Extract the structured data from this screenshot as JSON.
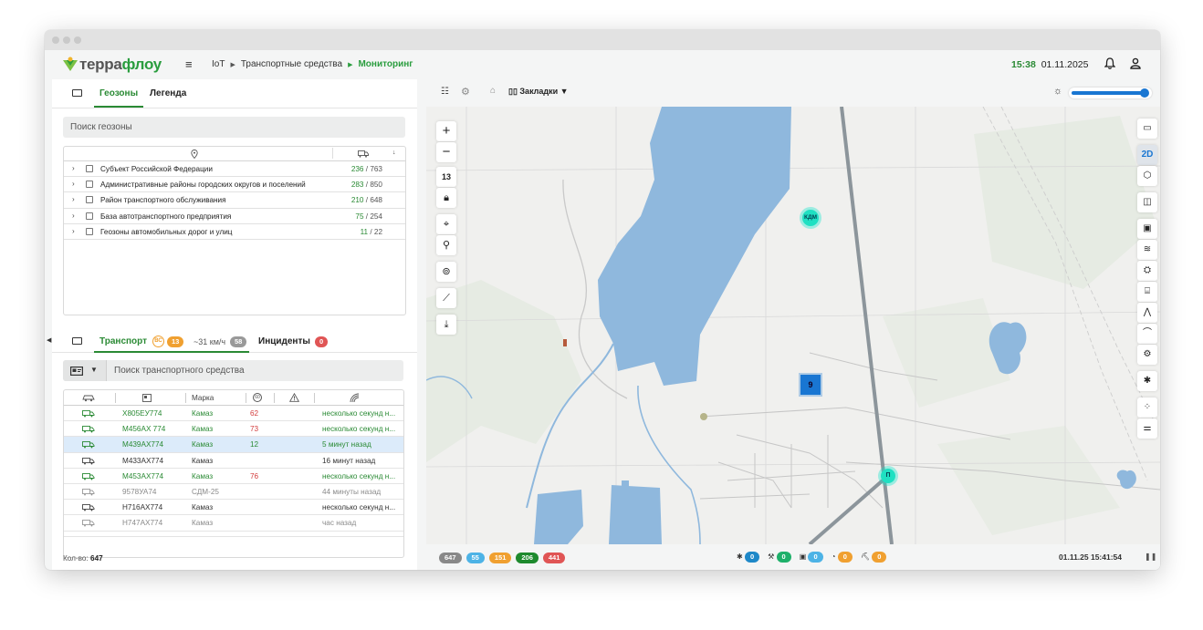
{
  "app": {
    "logo_part1": "терра",
    "logo_part2": "флоу",
    "menu_icon": "≡",
    "breadcrumb": [
      "IoT",
      "Транспортные средства",
      "Мониторинг"
    ],
    "time": "15:38",
    "date": "01.11.2025"
  },
  "geozones": {
    "tabs": [
      "Геозоны",
      "Легенда"
    ],
    "search_placeholder": "Поиск геозоны",
    "rows": [
      {
        "name": "Субъект Российской Федерации",
        "a": "236",
        "b": "763"
      },
      {
        "name": "Административные районы городских округов и поселений",
        "a": "283",
        "b": "850"
      },
      {
        "name": "Район транспортного обслуживания",
        "a": "210",
        "b": "648"
      },
      {
        "name": "База автотранспортного предприятия",
        "a": "75",
        "b": "254"
      },
      {
        "name": "Геозоны автомобильных дорог и улиц",
        "a": "11",
        "b": "22"
      }
    ]
  },
  "transport": {
    "tab_transport": "Транспорт",
    "count_badge": "13",
    "speed_label": "~31 км/ч",
    "speed_badge": "58",
    "tab_incidents": "Инциденты",
    "incidents_badge": "0",
    "search_placeholder": "Поиск транспортного средства",
    "col_brand": "Марка",
    "rows": [
      {
        "plate": "Х805ЕУ774",
        "brand": "Камаз",
        "speed": "62",
        "time": "несколько секунд н...",
        "style": "green"
      },
      {
        "plate": "М456АХ 774",
        "brand": "Камаз",
        "speed": "73",
        "time": "несколько секунд н...",
        "style": "green"
      },
      {
        "plate": "М439АХ774",
        "brand": "Камаз",
        "speed": "12",
        "time": "5 минут назад",
        "style": "green-sel"
      },
      {
        "plate": "М433АХ774",
        "brand": "Камаз",
        "speed": "",
        "time": "16 минут назад",
        "style": "dark"
      },
      {
        "plate": "М453АХ774",
        "brand": "Камаз",
        "speed": "76",
        "time": "несколько секунд н...",
        "style": "green"
      },
      {
        "plate": "9578УА74",
        "brand": "СДМ-25",
        "speed": "",
        "time": "44 минуты назад",
        "style": "gray"
      },
      {
        "plate": "Н716АХ774",
        "brand": "Камаз",
        "speed": "",
        "time": "несколько секунд н...",
        "style": "dark"
      },
      {
        "plate": "Н747АХ774",
        "brand": "Камаз",
        "speed": "",
        "time": "час назад",
        "style": "gray"
      }
    ],
    "total_label": "Кол-во:",
    "total_value": "647"
  },
  "map": {
    "bookmarks": "Закладки",
    "zoom_level": "13",
    "mode_2d": "2D",
    "cluster_label": "9",
    "marker_kdm": "КДМ",
    "marker_p": "П",
    "bottom_counts": [
      {
        "v": "647",
        "c": "#888888"
      },
      {
        "v": "55",
        "c": "#4db3e6"
      },
      {
        "v": "151",
        "c": "#f0a030"
      },
      {
        "v": "206",
        "c": "#1e8a2e"
      },
      {
        "v": "441",
        "c": "#e05555"
      }
    ],
    "status_counts": [
      "0",
      "0",
      "0",
      "0",
      "0"
    ],
    "timestamp": "01.11.25 15:41:54"
  }
}
